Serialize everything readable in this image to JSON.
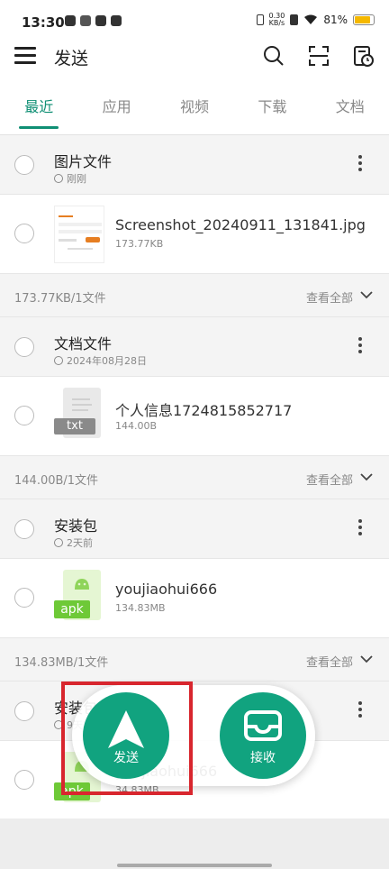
{
  "status_bar": {
    "time": "13:30",
    "net_speed_value": "0.30",
    "net_speed_unit": "KB/s",
    "battery": "81%",
    "battery_color": "#f5b800"
  },
  "app_bar": {
    "title": "发送"
  },
  "tabs": [
    {
      "label": "最近",
      "active": true
    },
    {
      "label": "应用",
      "active": false
    },
    {
      "label": "视频",
      "active": false
    },
    {
      "label": "下载",
      "active": false
    },
    {
      "label": "文档",
      "active": false
    }
  ],
  "groups": [
    {
      "title": "图片文件",
      "time": "刚刚",
      "file": {
        "name": "Screenshot_20240911_131841.jpg",
        "size": "173.77KB"
      },
      "summary": "173.77KB/1文件",
      "view_all": "查看全部"
    },
    {
      "title": "文档文件",
      "time": "2024年08月28日",
      "file": {
        "name": "个人信息1724815852717",
        "size": "144.00B",
        "badge": "txt"
      },
      "summary": "144.00B/1文件",
      "view_all": "查看全部"
    },
    {
      "title": "安装包",
      "time": "2天前",
      "file": {
        "name": "youjiaohui666",
        "size": "134.83MB",
        "badge": "apk"
      },
      "summary": "134.83MB/1文件",
      "view_all": "查看全部"
    },
    {
      "title": "安装包",
      "time": "9天前",
      "file": {
        "name": "youjiaohui666",
        "size": "34.83MB",
        "badge": "apk"
      }
    }
  ],
  "floating": {
    "send_label": "发送",
    "receive_label": "接收",
    "accent": "#11a37f",
    "highlight_color": "#d8262e"
  }
}
